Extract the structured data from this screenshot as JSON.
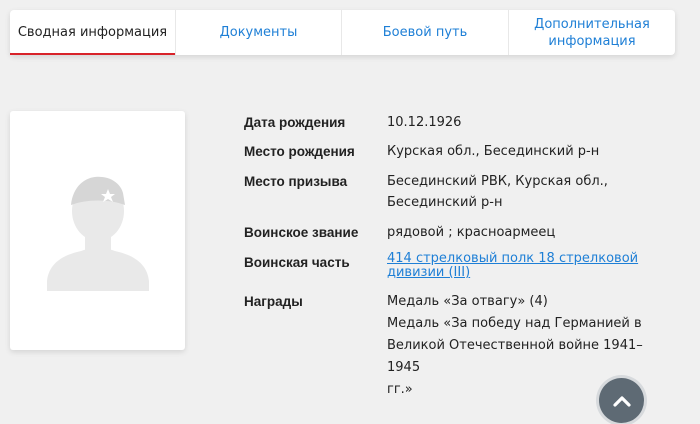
{
  "tabs": [
    {
      "label": "Сводная информация",
      "active": true
    },
    {
      "label": "Документы",
      "active": false
    },
    {
      "label": "Боевой путь",
      "active": false
    },
    {
      "label_line1": "Дополнительная",
      "label_line2": "информация",
      "active": false
    }
  ],
  "photo": {
    "icon": "soldier-silhouette-icon"
  },
  "info": {
    "birth_date": {
      "label": "Дата рождения",
      "value": "10.12.1926"
    },
    "birth_place": {
      "label": "Место рождения",
      "value": "Курская обл., Бесединский р-н"
    },
    "conscription_place": {
      "label": "Место призыва",
      "value_line1": "Бесединский РВК, Курская обл.,",
      "value_line2": "Бесединский р-н"
    },
    "rank": {
      "label": "Воинское звание",
      "value": "рядовой ; красноармеец"
    },
    "unit": {
      "label": "Воинская часть",
      "value_line1": "414 стрелковый полк 18 стрелковой",
      "value_line2": "дивизии (III)"
    },
    "awards": {
      "label": "Награды",
      "items": [
        "Медаль «За отвагу» (4)",
        "Медаль «За победу над Германией в",
        "Великой Отечественной войне 1941–1945",
        "гг.»"
      ]
    }
  },
  "colors": {
    "link": "#1e7fd6",
    "active_tab_underline": "#d8232a",
    "background": "#f0f0f0"
  },
  "scroll_top": {
    "icon": "chevron-up-icon"
  }
}
